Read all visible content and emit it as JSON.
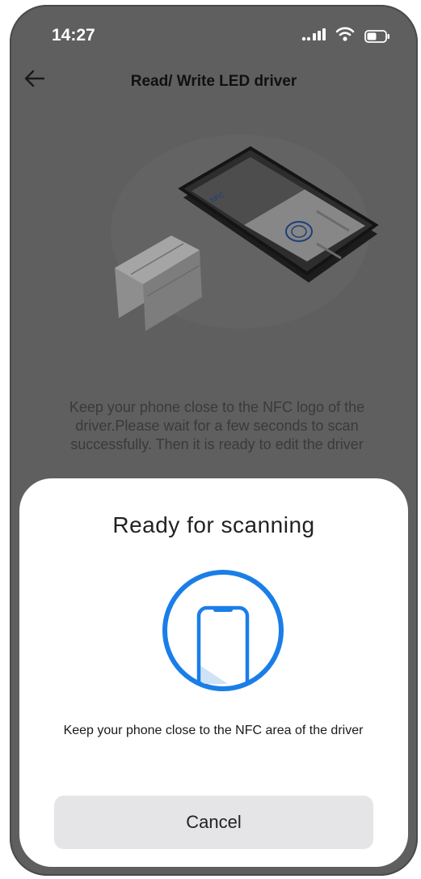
{
  "status_bar": {
    "time": "14:27"
  },
  "header": {
    "title": "Read/ Write LED driver"
  },
  "icons": {
    "back": "back-arrow-icon",
    "signal": "signal-icon",
    "wifi": "wifi-icon",
    "battery": "battery-icon",
    "nfc_text": "NFC"
  },
  "main": {
    "instructions": "Keep your phone close to the NFC logo of the driver.Please wait for a few seconds to scan successfully. Then it is ready to edit the driver"
  },
  "sheet": {
    "title": "Ready for scanning",
    "message": "Keep your phone close to the NFC area of the driver",
    "cancel_label": "Cancel"
  },
  "colors": {
    "accent": "#1a7ee8",
    "overlay": "#5f5f5f",
    "sheet": "#ffffff",
    "button": "#e5e5e8"
  }
}
